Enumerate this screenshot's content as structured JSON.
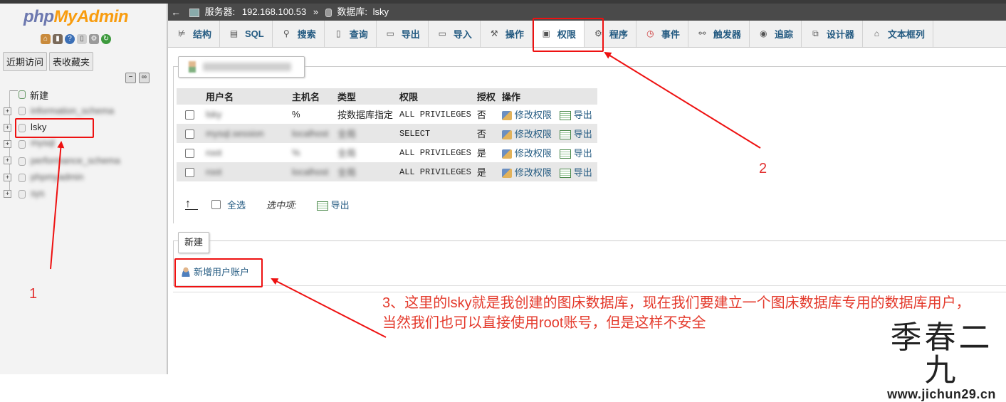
{
  "app": {
    "logo_left": "php",
    "logo_right": "MyAdmin"
  },
  "nav": {
    "tabs": [
      "近期访问",
      "表收藏夹"
    ],
    "tree": {
      "new": "新建",
      "databases": [
        "information_schema",
        "lsky",
        "mysql",
        "performance_schema",
        "phpmyadmin",
        "sys"
      ]
    }
  },
  "breadcrumb": {
    "back_icon": "left-arrow-icon",
    "server_label": "服务器:",
    "server": "192.168.100.53",
    "sep": "»",
    "database_label": "数据库:",
    "database": "lsky"
  },
  "tabs": [
    {
      "label": "结构",
      "icon": "structure-icon"
    },
    {
      "label": "SQL",
      "icon": "sql-icon"
    },
    {
      "label": "搜索",
      "icon": "search-icon"
    },
    {
      "label": "查询",
      "icon": "query-icon"
    },
    {
      "label": "导出",
      "icon": "export-icon"
    },
    {
      "label": "导入",
      "icon": "import-icon"
    },
    {
      "label": "操作",
      "icon": "wrench-icon"
    },
    {
      "label": "权限",
      "icon": "privileges-icon",
      "active": true
    },
    {
      "label": "程序",
      "icon": "routines-icon"
    },
    {
      "label": "事件",
      "icon": "events-icon"
    },
    {
      "label": "触发器",
      "icon": "triggers-icon"
    },
    {
      "label": "追踪",
      "icon": "tracking-icon"
    },
    {
      "label": "设计器",
      "icon": "designer-icon"
    },
    {
      "label": "文本框列",
      "icon": "central-columns-icon"
    }
  ],
  "table": {
    "headers": [
      "用户名",
      "主机名",
      "类型",
      "权限",
      "授权",
      "操作"
    ],
    "rows": [
      {
        "user": "lsky",
        "host": "%",
        "type": "按数据库指定",
        "priv": "ALL PRIVILEGES",
        "grant": "否",
        "edit": "修改权限",
        "export": "导出"
      },
      {
        "user": "mysql.session",
        "host": "localhost",
        "type": "全局",
        "priv": "SELECT",
        "grant": "否",
        "edit": "修改权限",
        "export": "导出"
      },
      {
        "user": "root",
        "host": "%",
        "type": "全局",
        "priv": "ALL PRIVILEGES",
        "grant": "是",
        "edit": "修改权限",
        "export": "导出"
      },
      {
        "user": "root",
        "host": "localhost",
        "type": "全局",
        "priv": "ALL PRIVILEGES",
        "grant": "是",
        "edit": "修改权限",
        "export": "导出"
      }
    ],
    "select_all": "全选",
    "with_selected": "选中项:",
    "export": "导出"
  },
  "new_section": {
    "legend": "新建",
    "add_user": "新增用户账户"
  },
  "annotations": {
    "n1": "1",
    "n2": "2",
    "note_line1": "3、这里的lsky就是我创建的图床数据库，现在我们要建立一个图床数据库专用的数据库用户，",
    "note_line2": "当然我们也可以直接使用root账号，但是这样不安全",
    "accent": "#ee1111"
  },
  "watermark": {
    "cn": "季春二九",
    "url": "www.jichun29.cn"
  }
}
